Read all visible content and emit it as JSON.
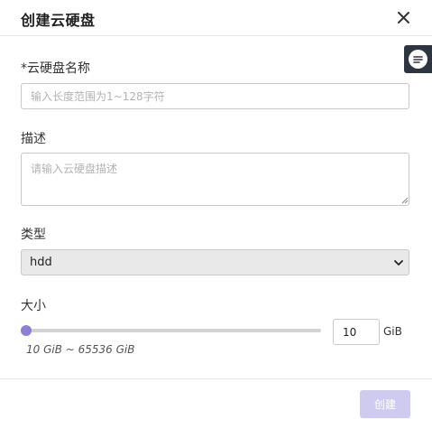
{
  "dialog": {
    "title": "创建云硬盘",
    "close_icon": "close-icon"
  },
  "feedback": {
    "icon": "chat-lines-icon",
    "colors": {
      "background": "#2f3441"
    }
  },
  "form": {
    "name": {
      "label": "*云硬盘名称",
      "value": "",
      "placeholder": "输入长度范围为1~128字符"
    },
    "description": {
      "label": "描述",
      "value": "",
      "placeholder": "请输入云硬盘描述"
    },
    "type": {
      "label": "类型",
      "selected": "hdd"
    },
    "size": {
      "label": "大小",
      "value": "10",
      "unit": "GiB",
      "range_text": "10 GiB ~ 65536 GiB",
      "min": 10,
      "max": 65536,
      "slider_fraction": 0.0
    }
  },
  "footer": {
    "create_label": "创建"
  },
  "colors": {
    "accent": "#8b80d4",
    "button_disabled": "#cfcbf0"
  }
}
